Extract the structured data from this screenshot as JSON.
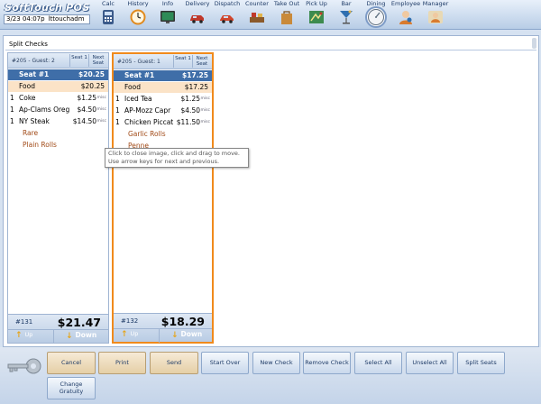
{
  "app_title": "SoftTouch POS",
  "status": {
    "time": "3/23 04:07p",
    "user": "lttouchadm"
  },
  "nav": [
    {
      "label": "Calc",
      "icon": "calculator-icon",
      "color": "#3b5a8a"
    },
    {
      "label": "History",
      "icon": "clock-icon",
      "color": "#e08a1e"
    },
    {
      "label": "Info",
      "icon": "monitor-icon",
      "color": "#2e8b57"
    },
    {
      "label": "Delivery",
      "icon": "delivery-car-icon",
      "color": "#c0392b"
    },
    {
      "label": "Dispatch",
      "icon": "dispatch-car-icon",
      "color": "#d0462c"
    },
    {
      "label": "Counter",
      "icon": "counter-icon",
      "color": "#c0392b"
    },
    {
      "label": "Take Out",
      "icon": "takeout-bag-icon",
      "color": "#c98a3a"
    },
    {
      "label": "Pick Up",
      "icon": "pickup-map-icon",
      "color": "#3d8b4f"
    },
    {
      "label": "Bar",
      "icon": "cocktail-icon",
      "color": "#2f6fb0"
    },
    {
      "label": "Dining",
      "icon": "dining-clock-icon",
      "color": "#607080"
    },
    {
      "label": "Employee",
      "icon": "employee-icon",
      "color": "#d87b2f"
    },
    {
      "label": "Manager",
      "icon": "manager-icon",
      "color": "#d87b2f"
    }
  ],
  "panel_title": "Split Checks",
  "checks": [
    {
      "guest_label": "#205 - Guest: 2",
      "seat_btn": "Seat 1",
      "next_seat_btn": "Next Seat",
      "seat": {
        "label": "Seat #1",
        "amount": "$20.25"
      },
      "category": {
        "label": "Food",
        "amount": "$20.25"
      },
      "items": [
        {
          "qty": "1",
          "name": "Coke",
          "price": "$1.25",
          "tag": "misc"
        },
        {
          "qty": "1",
          "name": "Ap-Clams Oreg",
          "price": "$4.50",
          "tag": "misc"
        },
        {
          "qty": "1",
          "name": "NY Steak",
          "price": "$14.50",
          "tag": "misc"
        }
      ],
      "modifiers": [
        "Rare",
        "Plain Rolls"
      ],
      "check_number": "#131",
      "total": "$21.47",
      "up_label": "Up",
      "down_label": "Down"
    },
    {
      "guest_label": "#205 - Guest: 1",
      "seat_btn": "Seat 1",
      "next_seat_btn": "Next Seat",
      "seat": {
        "label": "Seat #1",
        "amount": "$17.25"
      },
      "category": {
        "label": "Food",
        "amount": "$17.25"
      },
      "items": [
        {
          "qty": "1",
          "name": "Iced Tea",
          "price": "$1.25",
          "tag": "misc"
        },
        {
          "qty": "1",
          "name": "AP-Mozz Capr",
          "price": "$4.50",
          "tag": "misc"
        },
        {
          "qty": "1",
          "name": "Chicken Piccat",
          "price": "$11.50",
          "tag": "misc"
        }
      ],
      "modifiers": [
        "Garlic Rolls",
        "Penne"
      ],
      "check_number": "#132",
      "total": "$18.29",
      "up_label": "Up",
      "down_label": "Down"
    }
  ],
  "tooltip": "Click to close image, click and drag to move. Use arrow keys for next and previous.",
  "buttons": {
    "cancel": "Cancel",
    "print": "Print",
    "send": "Send",
    "start_over": "Start Over",
    "new_check": "New Check",
    "remove_check": "Remove Check",
    "select_all": "Select All",
    "unselect_all": "Unselect All",
    "split_seats": "Split Seats",
    "change_gratuity": "Change Gratuity"
  },
  "colors": {
    "selected_border": "#f08a1c",
    "seat_row": "#3f6ea8",
    "food_row": "#fbe3c7",
    "modifier_text": "#a14a17"
  }
}
